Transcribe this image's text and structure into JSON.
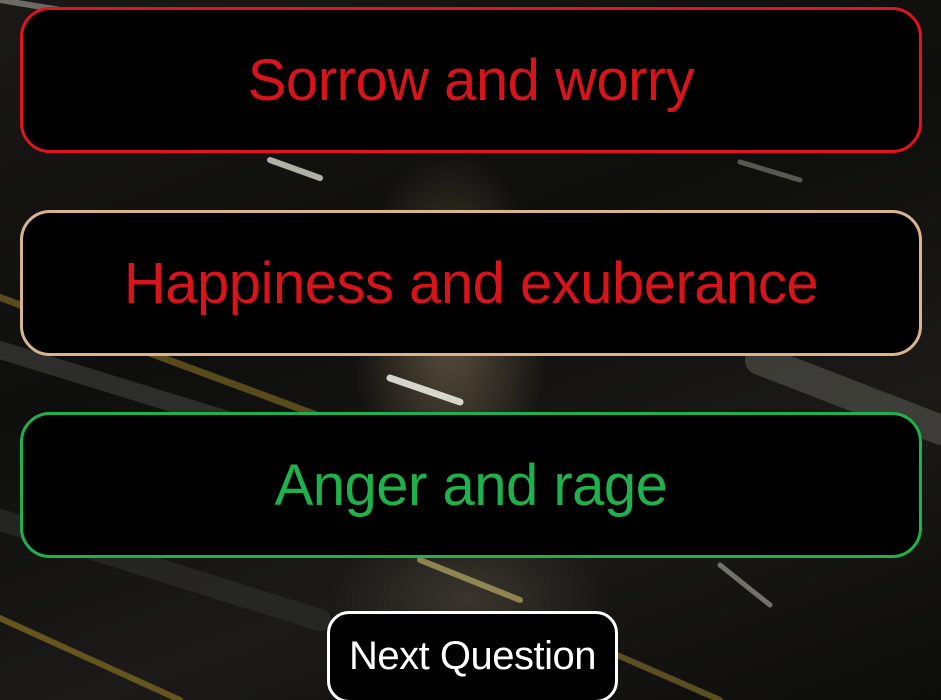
{
  "answers": [
    {
      "label": "Sorrow and worry",
      "border_color": "#e0141c",
      "text_color": "#d8141b",
      "state": "incorrect"
    },
    {
      "label": "Happiness and exuberance",
      "border_color": "#d9b48f",
      "text_color": "#d8141b",
      "state": "selected"
    },
    {
      "label": "Anger and rage",
      "border_color": "#1fb14b",
      "text_color": "#1fb14b",
      "state": "correct"
    }
  ],
  "next_button": {
    "label": "Next Question",
    "border_color": "#ffffff",
    "text_color": "#ffffff"
  }
}
